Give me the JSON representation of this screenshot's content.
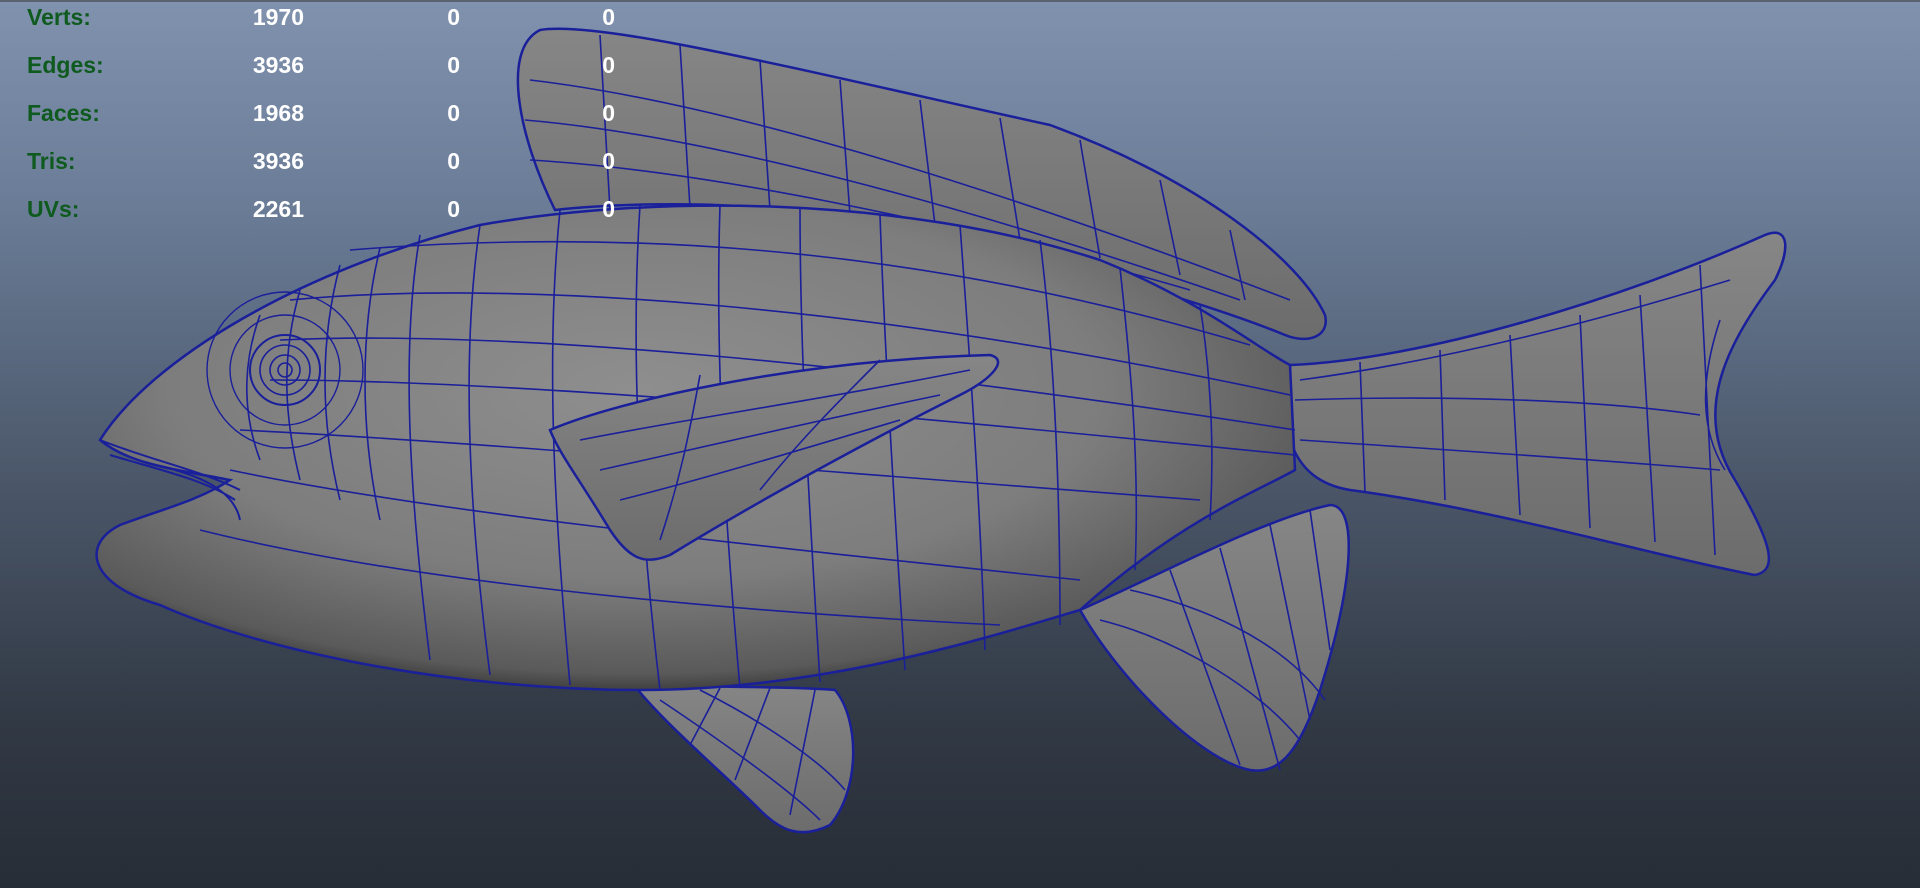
{
  "hud": {
    "rows": [
      {
        "label": "Verts:",
        "values": [
          "1970",
          "0",
          "0"
        ]
      },
      {
        "label": "Edges:",
        "values": [
          "3936",
          "0",
          "0"
        ]
      },
      {
        "label": "Faces:",
        "values": [
          "1968",
          "0",
          "0"
        ]
      },
      {
        "label": "Tris:",
        "values": [
          "3936",
          "0",
          "0"
        ]
      },
      {
        "label": "UVs:",
        "values": [
          "2261",
          "0",
          "0"
        ]
      }
    ]
  },
  "viewport": {
    "subject": "fish-model",
    "shading": "smooth-shaded-with-wireframe",
    "colors": {
      "wire": "#1a1f9a",
      "surface": "#7f7f7f",
      "hud_label": "#0f5a1e",
      "hud_value": "#ffffff",
      "bg_top": "#8092ae",
      "bg_bottom": "#272d36"
    }
  }
}
